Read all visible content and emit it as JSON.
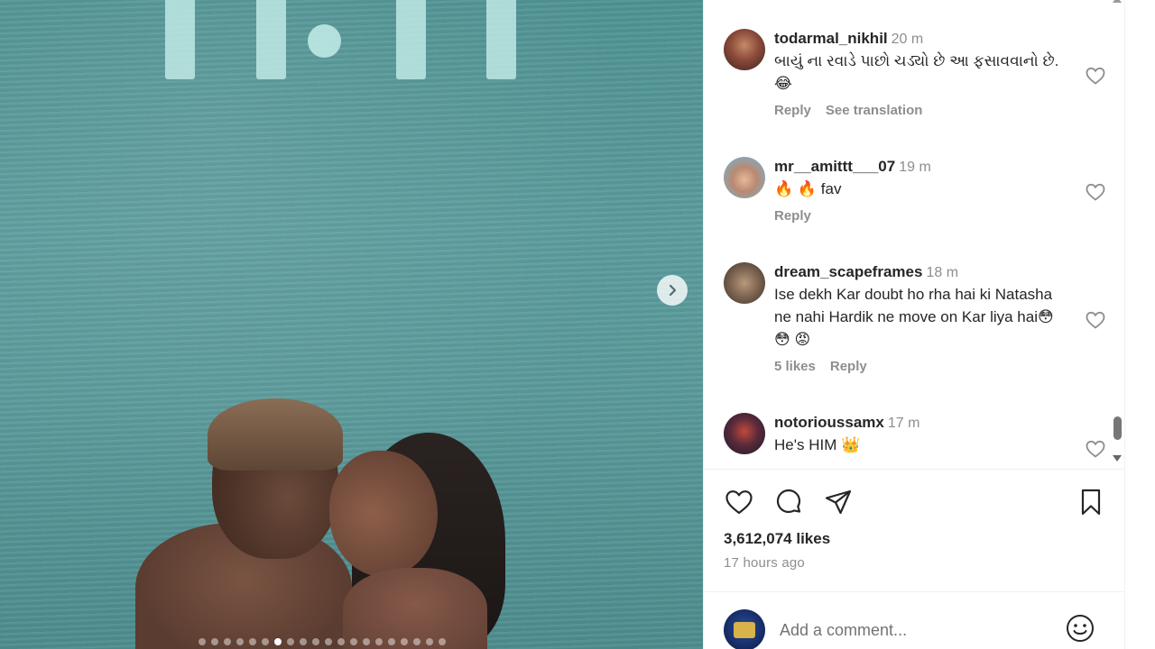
{
  "media": {
    "carousel_total": 20,
    "carousel_active": 6
  },
  "comments": [
    {
      "username": "todarmal_nikhil",
      "time": "20 m",
      "text": "બાયું ના રવાડે પાછો ચડ્યો છે આ ફસાવવાનો છે.😂",
      "actions": [
        "Reply",
        "See translation"
      ]
    },
    {
      "username": "mr__amittt___07",
      "time": "19 m",
      "text": "🔥 🔥  fav",
      "actions": [
        "Reply"
      ]
    },
    {
      "username": "dream_scapeframes",
      "time": "18 m",
      "text": "Ise dekh Kar doubt ho rha hai ki Natasha ne nahi Hardik ne move on Kar liya hai😳 😳 😡",
      "actions": [
        "5 likes",
        "Reply"
      ]
    },
    {
      "username": "notorioussamx",
      "time": "17 m",
      "text": "He's HIM 👑",
      "actions": []
    }
  ],
  "post": {
    "likes": "3,612,074 likes",
    "posted": "17 hours ago"
  },
  "add_comment": {
    "placeholder": "Add a comment..."
  },
  "icons": {
    "like": "heart-icon",
    "comment": "comment-bubble-icon",
    "share": "paper-plane-icon",
    "save": "bookmark-icon",
    "emoji": "smiley-icon",
    "next": "chevron-right-icon"
  }
}
